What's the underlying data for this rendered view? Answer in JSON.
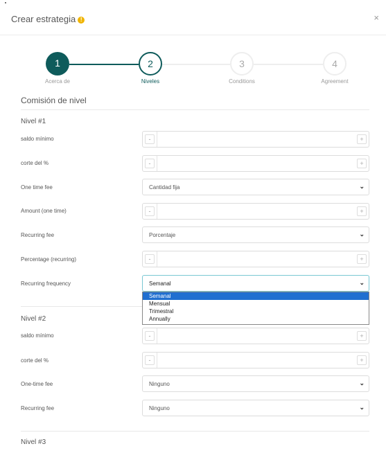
{
  "dialog": {
    "title": "Crear estrategia",
    "close": "×"
  },
  "steps": [
    {
      "number": "1",
      "label": "Acerca de"
    },
    {
      "number": "2",
      "label": "Niveles"
    },
    {
      "number": "3",
      "label": "Conditions"
    },
    {
      "number": "4",
      "label": "Agreement"
    }
  ],
  "section_title": "Comisión de nivel",
  "nivel1": {
    "title": "Nivel #1",
    "saldo_label": "saldo mínimo",
    "corte_label": "corte del %",
    "one_time_label": "One time fee",
    "one_time_value": "Cantidad fija",
    "amount_label": "Amount (one time)",
    "recurring_label": "Recurring fee",
    "recurring_value": "Porcentaje",
    "percentage_label": "Percentage (recurring)",
    "frequency_label": "Recurring frequency",
    "frequency_value": "Semanal"
  },
  "frequency_options": [
    "Semanal",
    "Mensual",
    "Trimestral",
    "Annually"
  ],
  "nivel2": {
    "title": "Nivel #2",
    "saldo_label": "saldo mínimo",
    "corte_label": "corte del %",
    "one_time_label": "One-time fee",
    "one_time_value": "Ninguno",
    "recurring_label": "Recurring fee",
    "recurring_value": "Ninguno"
  },
  "nivel3": {
    "title": "Nivel #3"
  },
  "input": {
    "minus": "-",
    "plus": "+"
  },
  "colors": {
    "step_active": "#0e5b5b",
    "step_line": "#0e5b5b",
    "info": "#f0b400",
    "selected_option": "#1f6fd0"
  }
}
